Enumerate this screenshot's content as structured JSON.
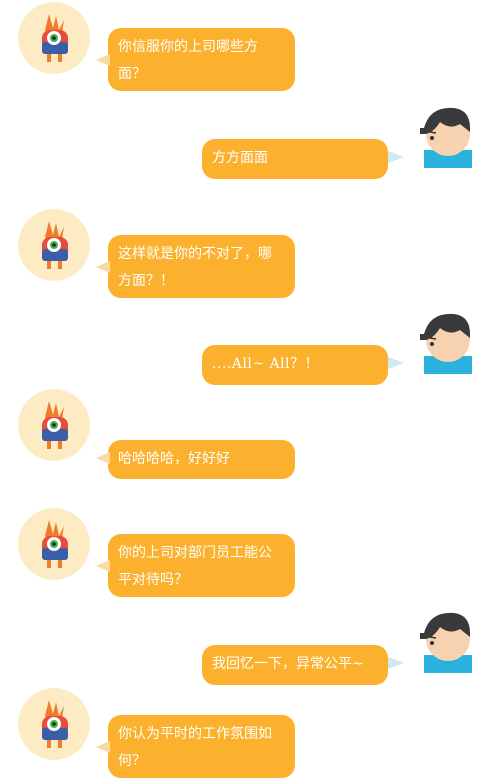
{
  "colors": {
    "bubble": "#fbb12d",
    "bubble_text": "#ffffff",
    "avatar_bg": "#fdebc3"
  },
  "messages": [
    {
      "from": "monster",
      "text": "你信服你的上司哪些方面？"
    },
    {
      "from": "user",
      "text": "方方面面"
    },
    {
      "from": "monster",
      "text": "这样就是你的不对了，哪方面？！"
    },
    {
      "from": "user",
      "text": "....All~  All？！"
    },
    {
      "from": "monster",
      "text": "哈哈哈哈，好好好"
    },
    {
      "from": "monster",
      "text": "你的上司对部门员工能公平对待吗？"
    },
    {
      "from": "user",
      "text": "我回忆一下，异常公平~"
    },
    {
      "from": "monster",
      "text": "你认为平时的工作氛围如何？"
    }
  ],
  "icons": {
    "monster": "one-eyed-monster-avatar",
    "user": "boy-avatar"
  }
}
